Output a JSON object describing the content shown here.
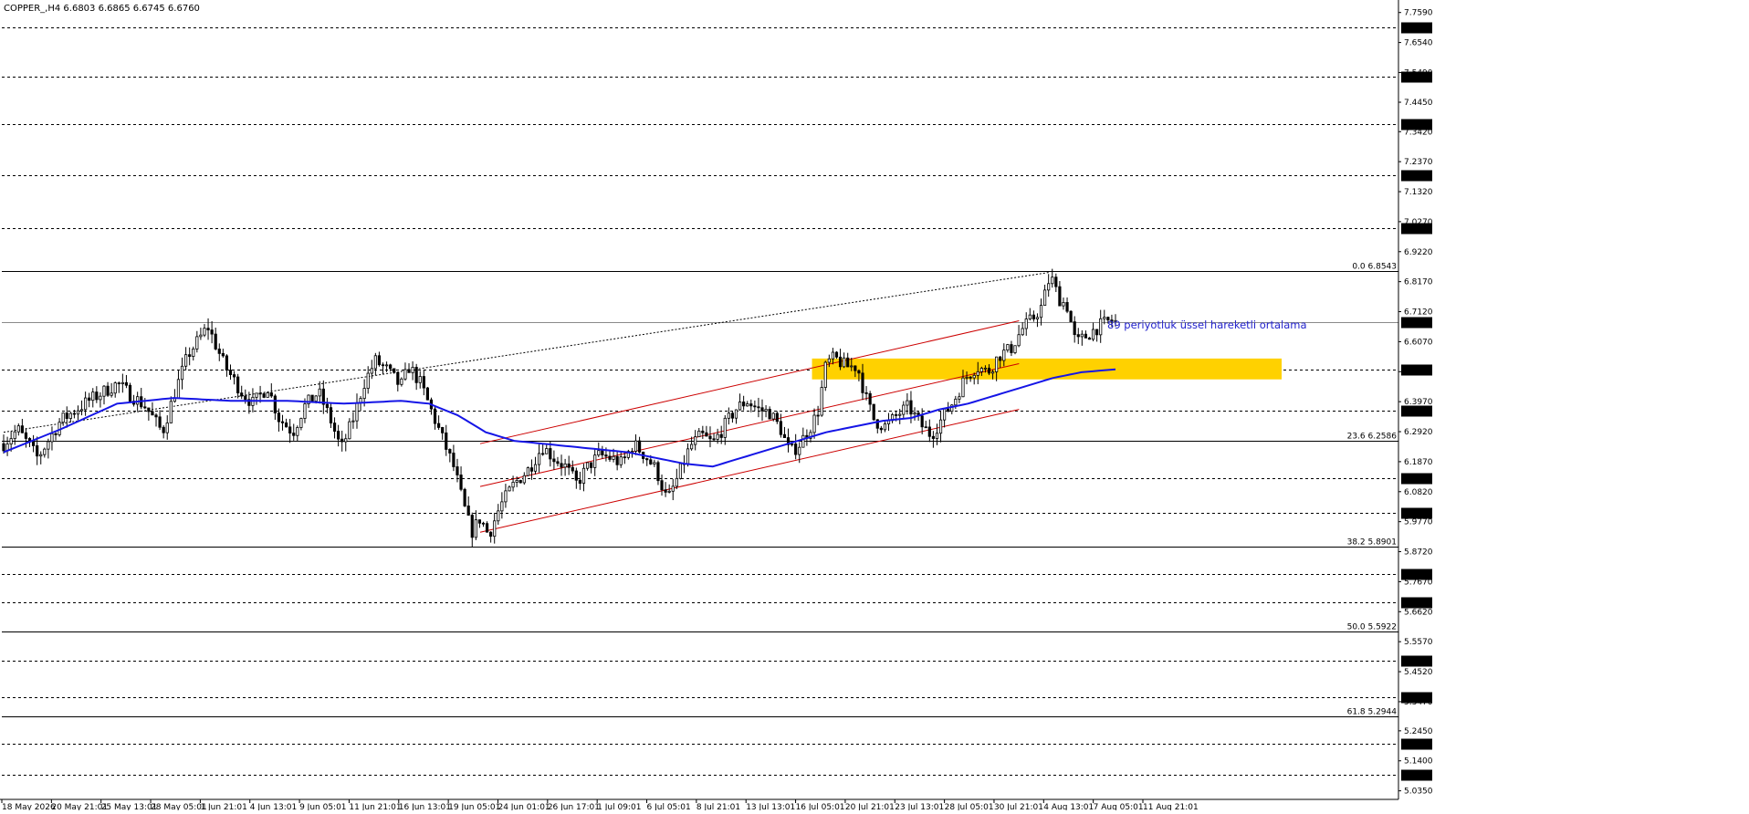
{
  "header": {
    "symbol_info": "COPPER_,H4  6.6803 6.6865 6.6745 6.6760"
  },
  "colors": {
    "background": "#ffffff",
    "candle": "#000000",
    "ema": "#1515e6",
    "channel": "#cc0000",
    "zone": "#ffd100",
    "grid_line": "#000000",
    "annotation": "#2222cc"
  },
  "chart_data": {
    "type": "candlestick",
    "symbol": "COPPER_",
    "timeframe": "H4",
    "ohlc": {
      "open": 6.6803,
      "high": 6.6865,
      "low": 6.6745,
      "close": 6.676
    },
    "ylim": [
      5.0,
      7.8
    ],
    "y_ticks": [
      "7.7590",
      "7.6540",
      "7.5490",
      "7.4450",
      "7.3420",
      "7.2370",
      "7.1320",
      "7.0270",
      "6.9220",
      "6.8170",
      "6.7120",
      "6.6070",
      "6.5020",
      "6.3970",
      "6.2920",
      "6.1870",
      "6.0820",
      "5.9770",
      "5.8720",
      "5.7670",
      "5.6620",
      "5.5570",
      "5.4520",
      "5.3470",
      "5.2450",
      "5.1400",
      "5.0350"
    ],
    "x_labels": [
      "18 May 2026",
      "20 May 21:01",
      "25 May 13:01",
      "28 May 05:01",
      "1 Jun 21:01",
      "4 Jun 13:01",
      "9 Jun 05:01",
      "11 Jun 21:01",
      "16 Jun 13:01",
      "19 Jun 05:01",
      "24 Jun 01:01",
      "26 Jun 17:01",
      "1 Jul 09:01",
      "6 Jul 05:01",
      "8 Jul 21:01",
      "13 Jul 13:01",
      "16 Jul 05:01",
      "20 Jul 21:01",
      "23 Jul 13:01",
      "28 Jul 05:01",
      "30 Jul 21:01",
      "4 Aug 13:01",
      "7 Aug 05:01",
      "11 Aug 21:01"
    ],
    "horizontal_levels": [
      {
        "value": 7.706,
        "label": "7.7060",
        "style": "dashed"
      },
      {
        "value": 7.535,
        "label": "7.5350",
        "style": "dashed"
      },
      {
        "value": 7.368,
        "label": "7.3680",
        "style": "dashed"
      },
      {
        "value": 7.191,
        "label": "7.1910",
        "style": "dashed"
      },
      {
        "value": 7.0045,
        "label": "7.0045",
        "style": "dashed"
      },
      {
        "value": 6.5095,
        "label": "6.5095",
        "style": "dashed"
      },
      {
        "value": 6.366,
        "label": "6.3660",
        "style": "dashed"
      },
      {
        "value": 6.1305,
        "label": "6.1305",
        "style": "dashed"
      },
      {
        "value": 6.0075,
        "label": "6.0075",
        "style": "dashed"
      },
      {
        "value": 5.7935,
        "label": "5.7935",
        "style": "dashed"
      },
      {
        "value": 5.696,
        "label": "5.6960",
        "style": "dashed"
      },
      {
        "value": 5.4905,
        "label": "5.4905",
        "style": "dashed"
      },
      {
        "value": 5.3615,
        "label": "5.3615",
        "style": "dashed"
      },
      {
        "value": 5.2005,
        "label": "5.2005",
        "style": "dashed"
      },
      {
        "value": 5.0925,
        "label": "5.0925",
        "style": "dashed"
      }
    ],
    "current_price": {
      "value": 6.676,
      "label": "6.6760"
    },
    "fibonacci": [
      {
        "value": 6.8543,
        "label": "0.0 6.8543"
      },
      {
        "value": 6.2586,
        "label": "23.6 6.2586"
      },
      {
        "value": 5.8901,
        "label": "38.2 5.8901"
      },
      {
        "value": 5.5922,
        "label": "50.0 5.5922"
      },
      {
        "value": 5.2944,
        "label": "61.8 5.2944"
      }
    ],
    "annotation": "89 periyotluk üssel hareketli ortalama",
    "zone": {
      "from": 6.475,
      "to": 6.548,
      "color": "#ffd100"
    },
    "ema_period": 89,
    "candle_count": 300,
    "price_path": [
      [
        0,
        6.25
      ],
      [
        5,
        6.3
      ],
      [
        12,
        6.2
      ],
      [
        20,
        6.33
      ],
      [
        30,
        6.4
      ],
      [
        40,
        6.46
      ],
      [
        50,
        6.38
      ],
      [
        56,
        6.29
      ],
      [
        60,
        6.42
      ],
      [
        65,
        6.56
      ],
      [
        72,
        6.66
      ],
      [
        78,
        6.52
      ],
      [
        84,
        6.43
      ],
      [
        88,
        6.39
      ],
      [
        93,
        6.45
      ],
      [
        97,
        6.34
      ],
      [
        102,
        6.29
      ],
      [
        106,
        6.38
      ],
      [
        111,
        6.43
      ],
      [
        115,
        6.34
      ],
      [
        119,
        6.23
      ],
      [
        123,
        6.33
      ],
      [
        127,
        6.46
      ],
      [
        131,
        6.54
      ],
      [
        135,
        6.51
      ],
      [
        140,
        6.45
      ],
      [
        143,
        6.52
      ],
      [
        147,
        6.46
      ],
      [
        151,
        6.36
      ],
      [
        155,
        6.26
      ],
      [
        159,
        6.16
      ],
      [
        162,
        6.04
      ],
      [
        165,
        5.94
      ],
      [
        168,
        5.99
      ],
      [
        171,
        5.93
      ],
      [
        175,
        6.03
      ],
      [
        180,
        6.11
      ],
      [
        185,
        6.16
      ],
      [
        190,
        6.24
      ],
      [
        194,
        6.2
      ],
      [
        198,
        6.17
      ],
      [
        202,
        6.11
      ],
      [
        206,
        6.17
      ],
      [
        210,
        6.21
      ],
      [
        214,
        6.2
      ],
      [
        218,
        6.18
      ],
      [
        222,
        6.25
      ],
      [
        226,
        6.21
      ],
      [
        230,
        6.16
      ],
      [
        234,
        6.05
      ],
      [
        238,
        6.14
      ],
      [
        242,
        6.24
      ],
      [
        246,
        6.28
      ],
      [
        250,
        6.25
      ],
      [
        254,
        6.31
      ],
      [
        258,
        6.37
      ],
      [
        262,
        6.4
      ],
      [
        266,
        6.37
      ],
      [
        270,
        6.36
      ],
      [
        274,
        6.3
      ],
      [
        277,
        6.22
      ],
      [
        280,
        6.24
      ],
      [
        284,
        6.3
      ],
      [
        287,
        6.36
      ],
      [
        290,
        6.53
      ],
      [
        293,
        6.55
      ],
      [
        297,
        6.52
      ],
      [
        301,
        6.52
      ],
      [
        304,
        6.41
      ],
      [
        307,
        6.33
      ],
      [
        311,
        6.31
      ],
      [
        315,
        6.35
      ],
      [
        319,
        6.38
      ],
      [
        323,
        6.32
      ],
      [
        327,
        6.28
      ],
      [
        331,
        6.34
      ],
      [
        335,
        6.4
      ],
      [
        339,
        6.48
      ],
      [
        343,
        6.52
      ],
      [
        347,
        6.5
      ],
      [
        351,
        6.56
      ],
      [
        355,
        6.58
      ],
      [
        359,
        6.65
      ],
      [
        363,
        6.69
      ],
      [
        366,
        6.73
      ],
      [
        369,
        6.84
      ],
      [
        372,
        6.76
      ],
      [
        375,
        6.73
      ],
      [
        378,
        6.6
      ],
      [
        382,
        6.63
      ],
      [
        386,
        6.66
      ],
      [
        390,
        6.68
      ],
      [
        392,
        6.676
      ]
    ],
    "ema_path": [
      [
        0,
        6.22
      ],
      [
        20,
        6.3
      ],
      [
        40,
        6.39
      ],
      [
        60,
        6.41
      ],
      [
        80,
        6.4
      ],
      [
        100,
        6.4
      ],
      [
        120,
        6.39
      ],
      [
        140,
        6.4
      ],
      [
        150,
        6.39
      ],
      [
        160,
        6.35
      ],
      [
        170,
        6.29
      ],
      [
        180,
        6.26
      ],
      [
        190,
        6.25
      ],
      [
        200,
        6.24
      ],
      [
        210,
        6.23
      ],
      [
        220,
        6.22
      ],
      [
        230,
        6.2
      ],
      [
        240,
        6.18
      ],
      [
        250,
        6.17
      ],
      [
        260,
        6.2
      ],
      [
        270,
        6.23
      ],
      [
        280,
        6.26
      ],
      [
        290,
        6.29
      ],
      [
        300,
        6.31
      ],
      [
        310,
        6.33
      ],
      [
        320,
        6.34
      ],
      [
        330,
        6.37
      ],
      [
        340,
        6.39
      ],
      [
        350,
        6.42
      ],
      [
        360,
        6.45
      ],
      [
        370,
        6.48
      ],
      [
        380,
        6.5
      ],
      [
        392,
        6.51
      ]
    ]
  }
}
